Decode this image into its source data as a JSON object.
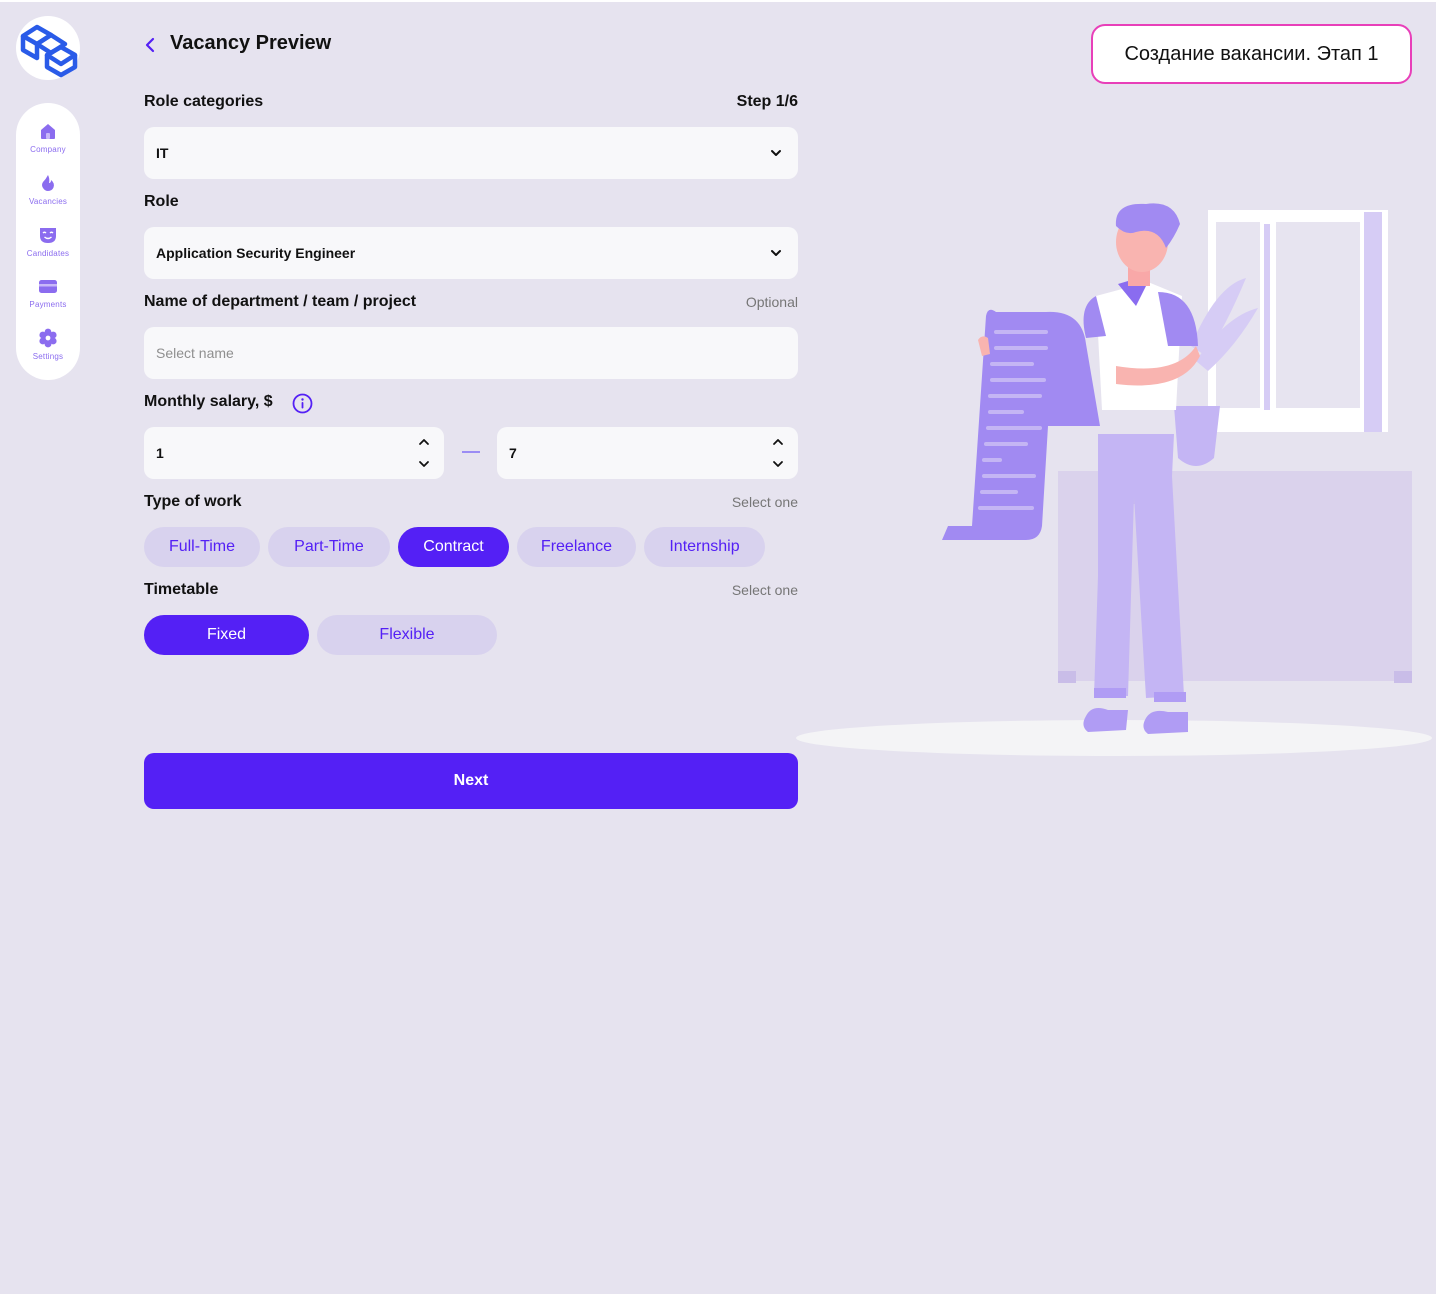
{
  "header": {
    "title": "Vacancy Preview",
    "stage_badge": "Создание вакансии. Этап 1"
  },
  "sidebar": {
    "items": [
      {
        "label": "Company",
        "icon": "home-icon"
      },
      {
        "label": "Vacancies",
        "icon": "flame-icon"
      },
      {
        "label": "Candidates",
        "icon": "mask-icon"
      },
      {
        "label": "Payments",
        "icon": "card-icon"
      },
      {
        "label": "Settings",
        "icon": "gear-icon"
      }
    ]
  },
  "form": {
    "step": "Step 1/6",
    "role_categories": {
      "label": "Role categories",
      "value": "IT"
    },
    "role": {
      "label": "Role",
      "value": "Application Security Engineer"
    },
    "department": {
      "label": "Name of department / team / project",
      "hint": "Optional",
      "placeholder": "Select name"
    },
    "salary": {
      "label": "Monthly salary, $",
      "min": "1",
      "max": "7"
    },
    "type_of_work": {
      "label": "Type of work",
      "hint": "Select one",
      "options": [
        "Full-Time",
        "Part-Time",
        "Contract",
        "Freelance",
        "Internship"
      ],
      "selected": "Contract"
    },
    "timetable": {
      "label": "Timetable",
      "hint": "Select one",
      "options": [
        "Fixed",
        "Flexible"
      ],
      "selected": "Fixed"
    },
    "next_label": "Next"
  },
  "colors": {
    "accent": "#5420F5",
    "pill_bg": "#D8D2EE",
    "badge_border": "#E83FB9",
    "background": "#E6E3EF"
  }
}
